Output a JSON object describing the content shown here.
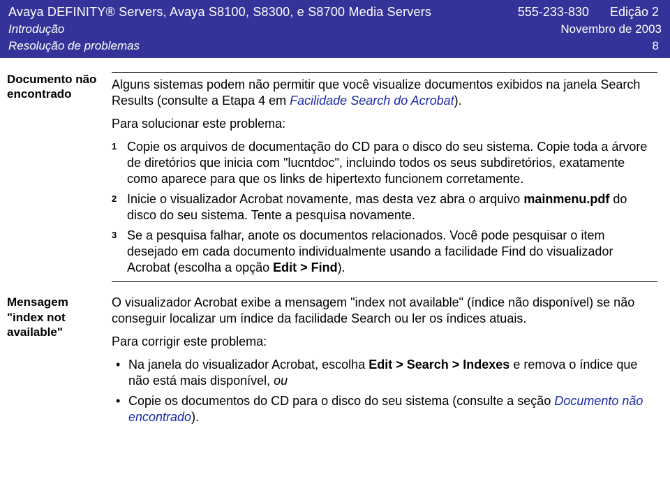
{
  "header": {
    "title": "Avaya DEFINITY® Servers, Avaya S8100, S8300, e S8700 Media Servers",
    "phone": "555-233-830",
    "edition": "Edição 2",
    "section": "Introdução",
    "date": "Novembro de 2003",
    "subsection": "Resolução de problemas",
    "page": "8"
  },
  "block1": {
    "label_l1": "Documento não",
    "label_l2": "encontrado",
    "p1a": "Alguns sistemas podem não permitir que você visualize documentos exibidos na janela Search Results (consulte a Etapa 4 em ",
    "p1link": "Facilidade Search do Acrobat",
    "p1b": ").",
    "p2": "Para solucionar este problema:",
    "step1a": "Copie os arquivos de documentação do CD para o disco do seu sistema. Copie toda a árvore de diretórios que inicia com \"lucntdoc\", incluindo todos os seus subdiretórios, exatamente como aparece para que os links de hipertexto funcionem corretamente.",
    "step2a": "Inicie o visualizador Acrobat novamente, mas desta vez abra o arquivo ",
    "step2bold": "mainmenu.pdf",
    "step2b": " do disco do seu sistema. Tente a pesquisa novamente.",
    "step3a": "Se a pesquisa falhar, anote os documentos relacionados. Você pode pesquisar o item desejado em cada documento individualmente usando a facilidade Find do visualizador Acrobat (escolha a opção ",
    "step3bold": "Edit > Find",
    "step3b": ")."
  },
  "block2": {
    "label_l1": "Mensagem",
    "label_l2": "\"index not",
    "label_l3": "available\"",
    "p1": "O visualizador Acrobat exibe a mensagem \"index not available\" (índice não disponível) se não conseguir localizar um índice da facilidade Search ou ler os índices atuais.",
    "p2": "Para corrigir este problema:",
    "b1a": "Na janela do visualizador Acrobat, escolha ",
    "b1bold": "Edit > Search > Indexes",
    "b1b": " e remova o índice que não está mais disponível, ",
    "b1italic": "ou",
    "b2a": "Copie os documentos do CD para o disco do seu sistema (consulte a seção ",
    "b2link": "Documento não encontrado",
    "b2b": ")."
  },
  "nums": {
    "n1": "1",
    "n2": "2",
    "n3": "3"
  }
}
